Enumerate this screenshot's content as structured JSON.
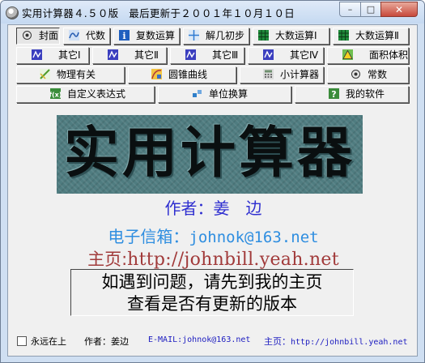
{
  "window": {
    "title": "实用计算器４.５０版　最后更新于２００１年１０月１０日",
    "controls": {
      "minimize": "–",
      "maximize": "□",
      "close": "✕"
    }
  },
  "toolbar_rows": [
    [
      {
        "label": "封面",
        "icon": "gear-icon",
        "active": true
      },
      {
        "label": "代数",
        "icon": "function-icon"
      },
      {
        "label": "复数运算",
        "icon": "info-icon"
      },
      {
        "label": "解几初步",
        "icon": "axes-icon"
      },
      {
        "label": "大数运算Ⅰ",
        "icon": "grid-icon"
      },
      {
        "label": "大数运算Ⅱ",
        "icon": "grid-icon"
      }
    ],
    [
      {
        "label": "其它Ⅰ",
        "icon": "puzzle-icon"
      },
      {
        "label": "其它Ⅱ",
        "icon": "puzzle-icon"
      },
      {
        "label": "其它Ⅲ",
        "icon": "puzzle-icon"
      },
      {
        "label": "其它Ⅳ",
        "icon": "puzzle-icon"
      },
      {
        "label": "面积体积",
        "icon": "triangle-icon"
      }
    ],
    [
      {
        "label": "物理有关",
        "icon": "physics-icon"
      },
      {
        "label": "圆锥曲线",
        "icon": "curve-icon"
      },
      {
        "label": "小计算器",
        "icon": "calculator-icon"
      },
      {
        "label": "常数",
        "icon": "gear-icon"
      }
    ],
    [
      {
        "label": "自定义表达式",
        "icon": "fx-icon"
      },
      {
        "label": "单位换算",
        "icon": "cubes-icon"
      },
      {
        "label": "我的软件",
        "icon": "help-icon"
      }
    ]
  ],
  "banner_text": "实用计算器",
  "author_line": "作者：姜　边",
  "email_label": "电子信箱：",
  "email": "johnok@163.net",
  "home_label": "主页:",
  "home_url": "http://johnbill.yeah.net",
  "notice": [
    "如遇到问题，请先到我的主页",
    "查看是否有更新的版本"
  ],
  "footer": {
    "always_on_top": "永远在上",
    "author": "作者：姜边",
    "email": "E-MAIL:johnok@163.net",
    "home_label": "主页：",
    "home_url": "http://johnbill.yeah.net"
  },
  "icon_colors": {
    "gear-icon": "#9aa7b6",
    "function-icon": "#2a5fb3",
    "info-icon": "#1f5fbf",
    "axes-icon": "#2e7bd1",
    "grid-icon": "#1f8a3a",
    "puzzle-icon": "#3b3fbf",
    "triangle-icon": "#3a9a3a",
    "physics-icon": "#4e9c2b",
    "curve-icon": "#c9a23a",
    "calculator-icon": "#8a8a8a",
    "fx-icon": "#3a8d3a",
    "cubes-icon": "#2f7fc9",
    "help-icon": "#3b8c3b"
  }
}
